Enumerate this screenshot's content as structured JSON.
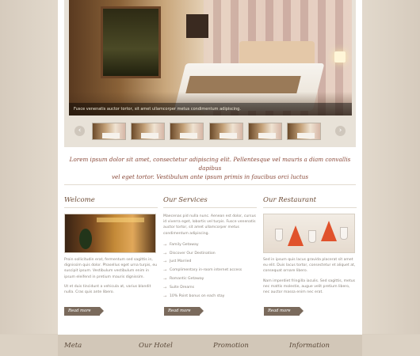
{
  "slider": {
    "caption": "Fusce venenatis auctor tortor, sit amet ullamcorper metus condimentum adipiscing.",
    "prev_icon": "chevron-left-icon",
    "next_icon": "chevron-right-icon",
    "prev_glyph": "‹",
    "next_glyph": "›",
    "thumbnail_count": 6
  },
  "intro": {
    "line1": "Lorem ipsum dolor sit amet, consectetur adipiscing elit. Pellentesque vel mauris a diam convallis dapibus",
    "line2": "vel eget tortor. Vestibulum ante ipsum primis in faucibus orci luctus"
  },
  "welcome": {
    "title": "Welcome",
    "p1": "Proin sollicitudin erat, fermentum sed sagittis in, dignissim quis dolor. Phasellus eget urna turpis, eu suscipit ipsum. Vestibulum vestibulum enim in ipsum eleifend in pretium mauris dignissim.",
    "p2": "Ut et duis tincidunt a vehicula at, varius blandit nulla. Cras quis ante libero.",
    "read_more": "Read more"
  },
  "services": {
    "title": "Our Services",
    "p1": "Maecenas pid nulla nunc. Aenean est dolor, cursus id viverra eget, lobortis vel turpis. Fusce venenatis auctor tortor, sit amet ullamcorper metus condimentum adipiscing.",
    "items": [
      "Family Getaway",
      "Discover Our Destination",
      "Just Married",
      "Complimentary in-room internet access",
      "Romantic Getaway",
      "Suite Dreams",
      "10% Point bonus on each stay"
    ],
    "read_more": "Read more"
  },
  "restaurant": {
    "title": "Our Restaurant",
    "p1": "Sed in ipsum quis lacus gravida placerat sit amet eu elit. Duis lacus tortor, consectetur et aliquet at, consequat ornare libero.",
    "p2": "Nam imperdiet fringilla iaculis. Sed sagittis, metus nec mattis molestie, augue velit pretium libero, nec auctor massa enim nec erat.",
    "read_more": "Read more"
  },
  "footer": {
    "items": [
      "Meta",
      "Our Hotel",
      "Promotion",
      "Information"
    ]
  }
}
